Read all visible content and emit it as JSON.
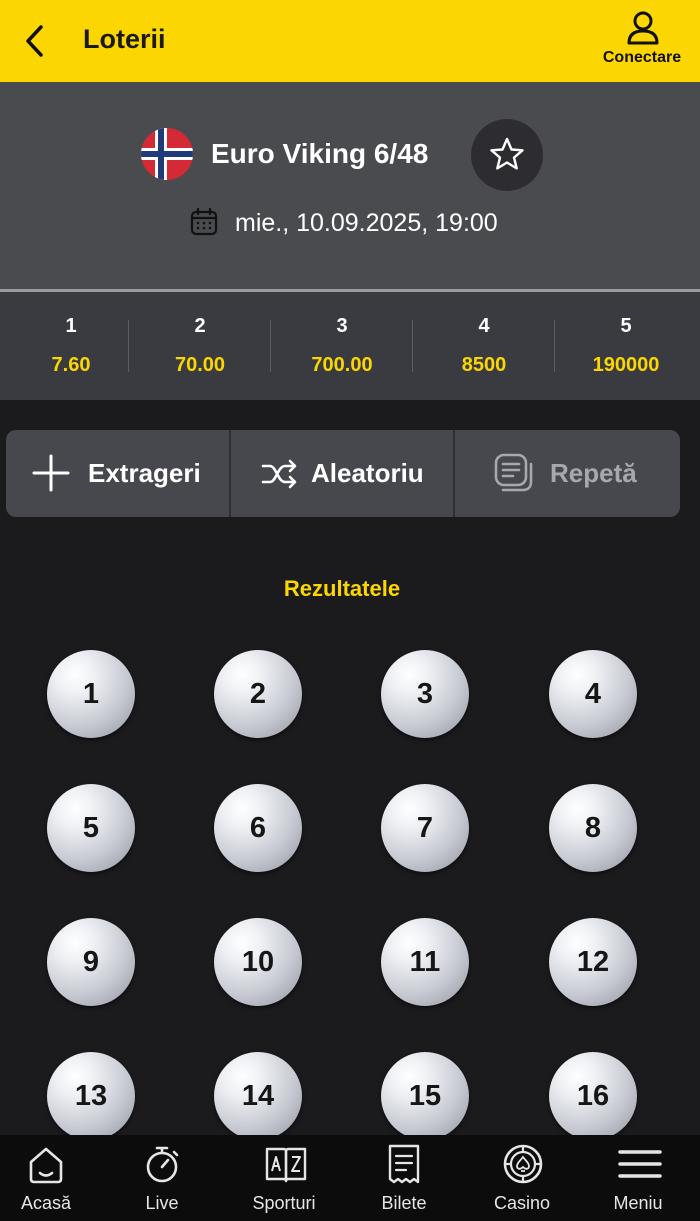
{
  "header": {
    "title": "Loterii",
    "login_label": "Conectare"
  },
  "event": {
    "name": "Euro Viking 6/48",
    "date": "mie., 10.09.2025, 19:00",
    "flag": "norway-flag"
  },
  "odds": [
    {
      "label": "1",
      "value": "7.60"
    },
    {
      "label": "2",
      "value": "70.00"
    },
    {
      "label": "3",
      "value": "700.00"
    },
    {
      "label": "4",
      "value": "8500"
    },
    {
      "label": "5",
      "value": "190000"
    }
  ],
  "actions": {
    "draws": "Extrageri",
    "random": "Aleatoriu",
    "repeat": "Repetă"
  },
  "results": {
    "title": "Rezultatele",
    "numbers": [
      "1",
      "2",
      "3",
      "4",
      "5",
      "6",
      "7",
      "8",
      "9",
      "10",
      "11",
      "12",
      "13",
      "14",
      "15",
      "16"
    ]
  },
  "nav": {
    "home": "Acasă",
    "live": "Live",
    "sports": "Sporturi",
    "tickets": "Bilete",
    "casino": "Casino",
    "menu": "Meniu"
  },
  "colors": {
    "accent": "#fcd600",
    "background": "#1b1b1e",
    "panel": "#4a4b4f"
  }
}
